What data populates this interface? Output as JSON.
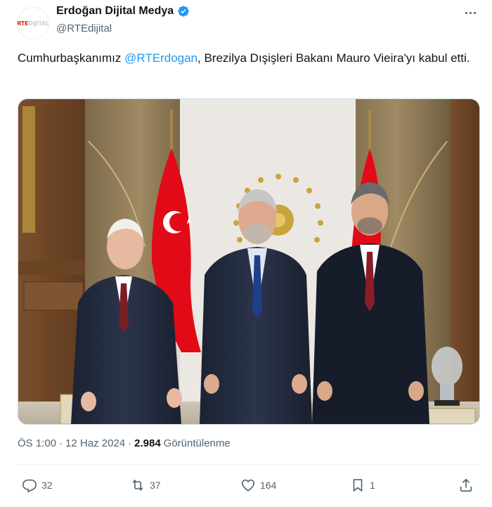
{
  "author": {
    "display_name": "Erdoğan Dijital Medya",
    "handle": "@RTEdijital",
    "avatar_text_a": "RTE",
    "avatar_text_b": "DIJITAL",
    "verified": true
  },
  "tweet": {
    "text_before": "Cumhurbaşkanımız ",
    "mention": "@RTErdogan",
    "text_after": ", Brezilya Dışişleri Bakanı Mauro Vieira'yı kabul etti."
  },
  "meta": {
    "time": "ÖS 1:00",
    "sep1": "·",
    "date": "12 Haz 2024",
    "sep2": "·",
    "views": "2.984",
    "views_label": "Görüntülenme"
  },
  "actions": {
    "replies": "32",
    "reposts": "37",
    "likes": "164",
    "bookmarks": "1"
  },
  "colors": {
    "accent": "#1d9bf0",
    "text": "#0f1419",
    "muted": "#536471",
    "flag_red": "#e30a17"
  },
  "icons": [
    "verified-badge-icon",
    "more-options-icon",
    "reply-icon",
    "repost-icon",
    "like-icon",
    "bookmark-icon",
    "share-icon"
  ]
}
